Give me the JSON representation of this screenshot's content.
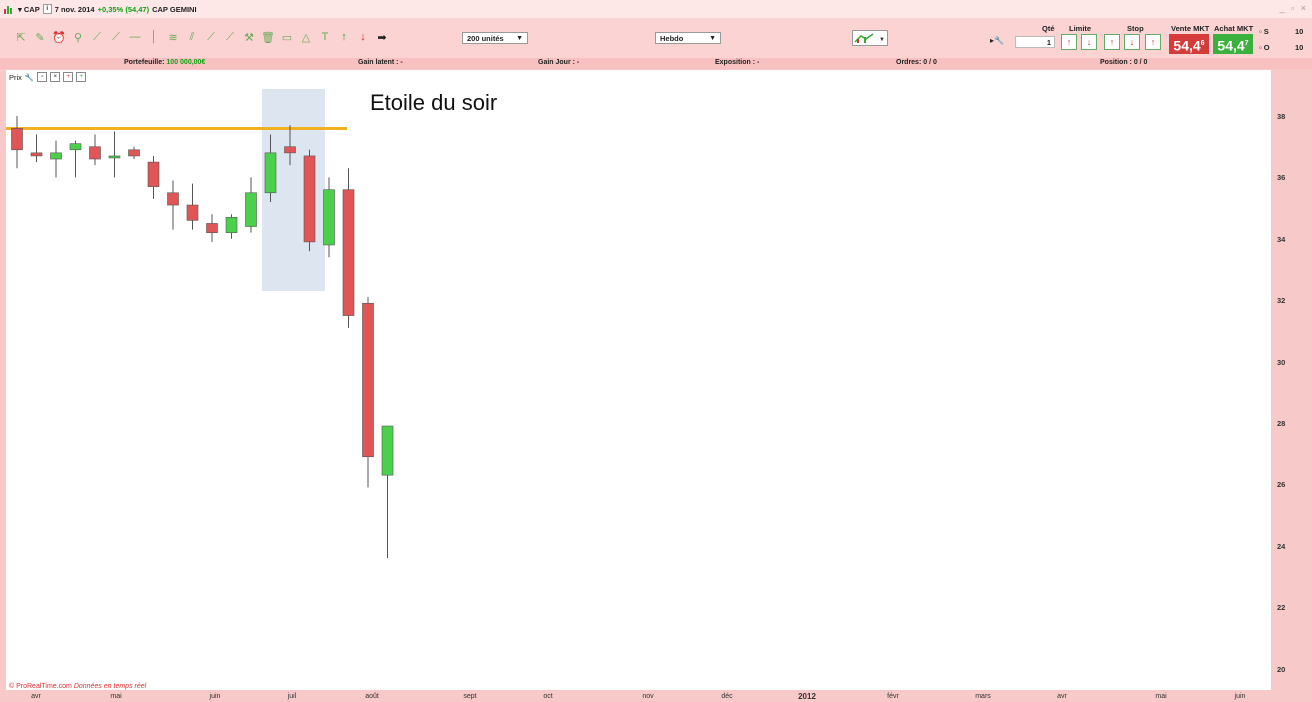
{
  "titlebar": {
    "symbol": "CAP",
    "date": "7 nov. 2014",
    "change": "+0,35% (54,47)",
    "name": "CAP GEMINI",
    "controls": "_ ▫ ×"
  },
  "toolbar": {
    "quantity_select": "200 unités",
    "period_select": "Hebdo",
    "tool_icons": [
      "pointer-icon",
      "pencil-icon",
      "alert-icon",
      "zoom-icon",
      "line-icon",
      "trendline-icon",
      "hline-icon",
      "vline-icon",
      "fibonacci-icon",
      "channel-icon",
      "fan-icon",
      "arc-icon",
      "hammer-icon",
      "trash-icon",
      "rectangle-icon",
      "triangle-icon",
      "text-icon",
      "up-arrow-icon",
      "down-arrow-icon",
      "right-arrow-icon"
    ]
  },
  "orderpanel": {
    "qty_label": "Qté",
    "limit_label": "Limite",
    "stop_label": "Stop",
    "sell_label": "Vente MKT",
    "buy_label": "Achat MKT",
    "qty_value": "1",
    "sell_price": "54,4",
    "sell_price_sup": "6",
    "buy_price": "54,4",
    "buy_price_sup": "7",
    "side_s": "S",
    "side_s_val": "10",
    "side_o": "O",
    "side_o_val": "10"
  },
  "infobar": {
    "portfolio_label": "Portefeuille:",
    "portfolio_value": "100 000,00€",
    "gain_latent": "Gain latent : -",
    "gain_jour": "Gain Jour : -",
    "exposition": "Exposition : -",
    "ordres": "Ordres: 0 / 0",
    "position": "Position : 0 / 0"
  },
  "chart_header": {
    "label": "Prix"
  },
  "annotation": "Etoile du soir",
  "watermark": {
    "brand": "© ProRealTime.com",
    "note": "Données en temps réel"
  },
  "colors": {
    "bull": "#4ad04a",
    "bear": "#e05555",
    "resistance": "#f0b020",
    "highlight": "#dde5f1"
  },
  "chart_data": {
    "type": "candlestick",
    "title": "",
    "ylim": [
      19.3,
      39.5
    ],
    "y_ticks": [
      "38",
      "36",
      "34",
      "32",
      "30",
      "28",
      "26",
      "24",
      "22",
      "20"
    ],
    "x_ticks": [
      "avr",
      "mai",
      "juin",
      "juil",
      "août",
      "sept",
      "oct",
      "nov",
      "déc",
      "2012",
      "févr",
      "mars",
      "avr",
      "mai",
      "juin"
    ],
    "resistance_level": 37.6,
    "candles": [
      {
        "open": 37.6,
        "high": 38.0,
        "low": 36.3,
        "close": 36.9
      },
      {
        "open": 36.8,
        "high": 37.4,
        "low": 36.5,
        "close": 36.7
      },
      {
        "open": 36.6,
        "high": 37.2,
        "low": 36.0,
        "close": 36.8
      },
      {
        "open": 36.9,
        "high": 37.2,
        "low": 36.0,
        "close": 37.1
      },
      {
        "open": 37.0,
        "high": 37.4,
        "low": 36.4,
        "close": 36.6
      },
      {
        "open": 36.7,
        "high": 37.5,
        "low": 36.0,
        "close": 36.7
      },
      {
        "open": 36.9,
        "high": 37.0,
        "low": 36.6,
        "close": 36.7
      },
      {
        "open": 36.5,
        "high": 36.7,
        "low": 35.3,
        "close": 35.7
      },
      {
        "open": 35.5,
        "high": 35.9,
        "low": 34.3,
        "close": 35.1
      },
      {
        "open": 35.1,
        "high": 35.8,
        "low": 34.3,
        "close": 34.6
      },
      {
        "open": 34.5,
        "high": 34.8,
        "low": 33.9,
        "close": 34.2
      },
      {
        "open": 34.2,
        "high": 34.8,
        "low": 34.0,
        "close": 34.7
      },
      {
        "open": 34.4,
        "high": 36.0,
        "low": 34.2,
        "close": 35.5
      },
      {
        "open": 35.5,
        "high": 37.4,
        "low": 35.2,
        "close": 36.8
      },
      {
        "open": 37.0,
        "high": 37.7,
        "low": 36.4,
        "close": 36.8
      },
      {
        "open": 36.7,
        "high": 36.9,
        "low": 33.6,
        "close": 33.9
      },
      {
        "open": 33.8,
        "high": 36.0,
        "low": 33.4,
        "close": 35.6
      },
      {
        "open": 35.6,
        "high": 36.3,
        "low": 31.1,
        "close": 31.5
      },
      {
        "open": 31.9,
        "high": 32.1,
        "low": 25.9,
        "close": 26.9
      },
      {
        "open": 26.3,
        "high": 27.9,
        "low": 23.6,
        "close": 27.9
      }
    ]
  }
}
